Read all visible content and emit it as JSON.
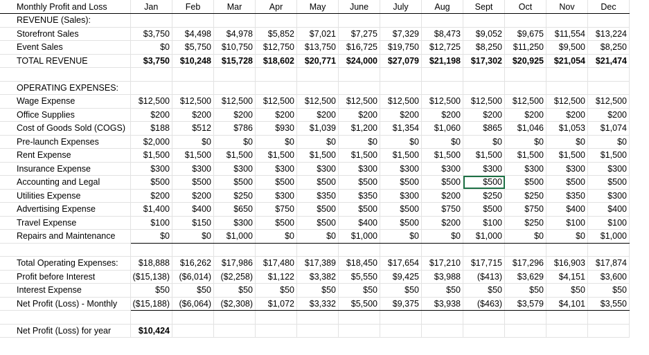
{
  "header": {
    "title": "Monthly Profit and Loss",
    "months": [
      "Jan",
      "Feb",
      "Mar",
      "Apr",
      "May",
      "June",
      "July",
      "Aug",
      "Sept",
      "Oct",
      "Nov",
      "Dec"
    ]
  },
  "revenue": {
    "section_label": "REVENUE (Sales):",
    "rows": [
      {
        "label": "Storefront Sales",
        "values": [
          "$3,750",
          "$4,498",
          "$4,978",
          "$5,852",
          "$7,021",
          "$7,275",
          "$7,329",
          "$8,473",
          "$9,052",
          "$9,675",
          "$11,554",
          "$13,224"
        ]
      },
      {
        "label": "Event Sales",
        "values": [
          "$0",
          "$5,750",
          "$10,750",
          "$12,750",
          "$13,750",
          "$16,725",
          "$19,750",
          "$12,725",
          "$8,250",
          "$11,250",
          "$9,500",
          "$8,250"
        ]
      }
    ],
    "total": {
      "label": "TOTAL REVENUE",
      "values": [
        "$3,750",
        "$10,248",
        "$15,728",
        "$18,602",
        "$20,771",
        "$24,000",
        "$27,079",
        "$21,198",
        "$17,302",
        "$20,925",
        "$21,054",
        "$21,474"
      ]
    }
  },
  "expenses": {
    "section_label": "OPERATING EXPENSES:",
    "rows": [
      {
        "label": "Wage Expense",
        "values": [
          "$12,500",
          "$12,500",
          "$12,500",
          "$12,500",
          "$12,500",
          "$12,500",
          "$12,500",
          "$12,500",
          "$12,500",
          "$12,500",
          "$12,500",
          "$12,500"
        ]
      },
      {
        "label": "Office Supplies",
        "values": [
          "$200",
          "$200",
          "$200",
          "$200",
          "$200",
          "$200",
          "$200",
          "$200",
          "$200",
          "$200",
          "$200",
          "$200"
        ]
      },
      {
        "label": "Cost of Goods Sold (COGS)",
        "values": [
          "$188",
          "$512",
          "$786",
          "$930",
          "$1,039",
          "$1,200",
          "$1,354",
          "$1,060",
          "$865",
          "$1,046",
          "$1,053",
          "$1,074"
        ]
      },
      {
        "label": "Pre-launch Expenses",
        "values": [
          "$2,000",
          "$0",
          "$0",
          "$0",
          "$0",
          "$0",
          "$0",
          "$0",
          "$0",
          "$0",
          "$0",
          "$0"
        ]
      },
      {
        "label": "Rent Expense",
        "values": [
          "$1,500",
          "$1,500",
          "$1,500",
          "$1,500",
          "$1,500",
          "$1,500",
          "$1,500",
          "$1,500",
          "$1,500",
          "$1,500",
          "$1,500",
          "$1,500"
        ]
      },
      {
        "label": "Insurance Expense",
        "values": [
          "$300",
          "$300",
          "$300",
          "$300",
          "$300",
          "$300",
          "$300",
          "$300",
          "$300",
          "$300",
          "$300",
          "$300"
        ]
      },
      {
        "label": "Accounting and Legal",
        "values": [
          "$500",
          "$500",
          "$500",
          "$500",
          "$500",
          "$500",
          "$500",
          "$500",
          "$500",
          "$500",
          "$500",
          "$500"
        ]
      },
      {
        "label": "Utilities Expense",
        "values": [
          "$200",
          "$200",
          "$250",
          "$300",
          "$350",
          "$350",
          "$300",
          "$200",
          "$250",
          "$250",
          "$350",
          "$300"
        ]
      },
      {
        "label": "Advertising Expense",
        "values": [
          "$1,400",
          "$400",
          "$650",
          "$750",
          "$500",
          "$500",
          "$500",
          "$750",
          "$500",
          "$750",
          "$400",
          "$400"
        ]
      },
      {
        "label": "Travel Expense",
        "values": [
          "$100",
          "$150",
          "$300",
          "$500",
          "$500",
          "$400",
          "$500",
          "$200",
          "$100",
          "$250",
          "$100",
          "$100"
        ]
      },
      {
        "label": "Repairs and Maintenance",
        "values": [
          "$0",
          "$0",
          "$1,000",
          "$0",
          "$0",
          "$1,000",
          "$0",
          "$0",
          "$1,000",
          "$0",
          "$0",
          "$1,000"
        ]
      }
    ]
  },
  "summary": {
    "rows": [
      {
        "label": "Total Operating Expenses:",
        "values": [
          "$18,888",
          "$16,262",
          "$17,986",
          "$17,480",
          "$17,389",
          "$18,450",
          "$17,654",
          "$17,210",
          "$17,715",
          "$17,296",
          "$16,903",
          "$17,874"
        ]
      },
      {
        "label": "Profit before Interest",
        "values": [
          "($15,138)",
          "($6,014)",
          "($2,258)",
          "$1,122",
          "$3,382",
          "$5,550",
          "$9,425",
          "$3,988",
          "($413)",
          "$3,629",
          "$4,151",
          "$3,600"
        ]
      },
      {
        "label": "Interest Expense",
        "values": [
          "$50",
          "$50",
          "$50",
          "$50",
          "$50",
          "$50",
          "$50",
          "$50",
          "$50",
          "$50",
          "$50",
          "$50"
        ]
      },
      {
        "label": "Net Profit (Loss) - Monthly",
        "values": [
          "($15,188)",
          "($6,064)",
          "($2,308)",
          "$1,072",
          "$3,332",
          "$5,500",
          "$9,375",
          "$3,938",
          "($463)",
          "$3,579",
          "$4,101",
          "$3,550"
        ]
      }
    ],
    "year_label": "Net Profit (Loss)  for year",
    "year_value": "$10,424"
  }
}
